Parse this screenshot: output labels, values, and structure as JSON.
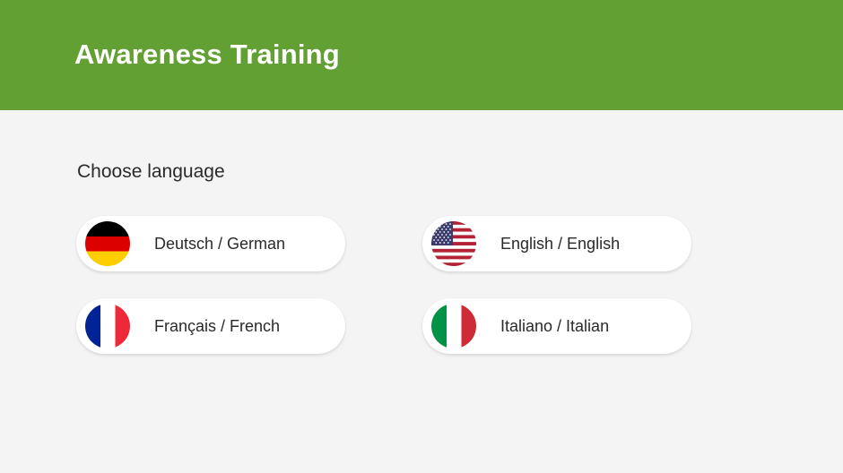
{
  "header": {
    "title": "Awareness Training",
    "background_color": "#62a033"
  },
  "main": {
    "choose_label": "Choose language",
    "languages": [
      {
        "label": "Deutsch / German",
        "flag_icon": "germany-flag-icon"
      },
      {
        "label": "English / English",
        "flag_icon": "usa-flag-icon"
      },
      {
        "label": "Français / French",
        "flag_icon": "france-flag-icon"
      },
      {
        "label": "Italiano / Italian",
        "flag_icon": "italy-flag-icon"
      }
    ]
  },
  "colors": {
    "page_background": "#f4f4f4",
    "button_background": "#ffffff",
    "text": "#2a2a2a"
  }
}
